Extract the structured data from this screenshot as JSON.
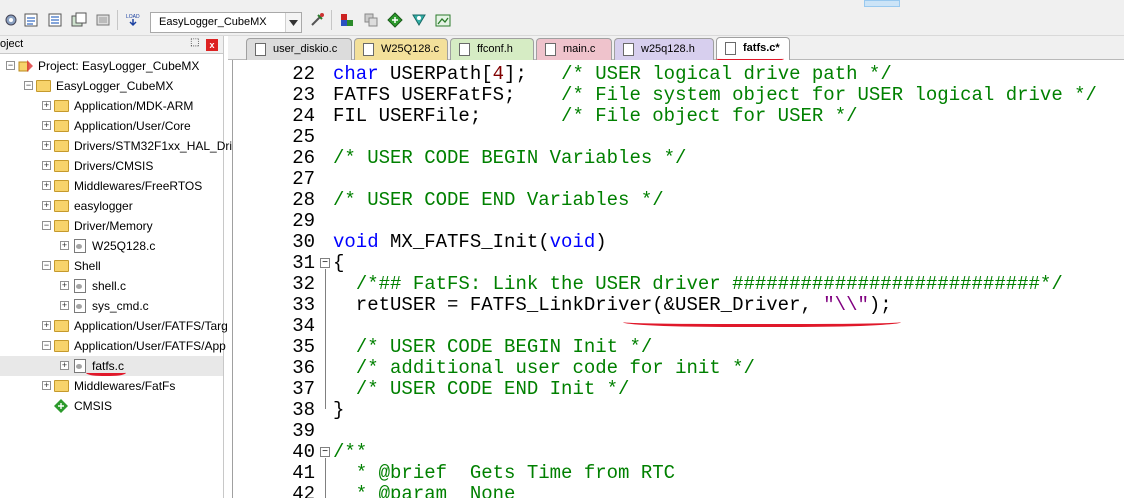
{
  "toolbar": {
    "target_name": "EasyLogger_CubeMX",
    "icons": [
      "settings-icon",
      "translate-icon",
      "build-icon",
      "rebuild-icon",
      "batch-build-icon",
      "download-icon",
      "target-options-icon",
      "manage-components-icon",
      "pack-installer-icon",
      "select-device-icon",
      "run-env-icon"
    ]
  },
  "project": {
    "panel_title": "oject",
    "pin": "⬚",
    "close": "x",
    "tree": [
      {
        "label": "Project: EasyLogger_CubeMX",
        "depth": 0,
        "expander": "−",
        "icon": "project"
      },
      {
        "label": "EasyLogger_CubeMX",
        "depth": 1,
        "expander": "−",
        "icon": "folder"
      },
      {
        "label": "Application/MDK-ARM",
        "depth": 2,
        "expander": "+",
        "icon": "folder"
      },
      {
        "label": "Application/User/Core",
        "depth": 2,
        "expander": "+",
        "icon": "folder"
      },
      {
        "label": "Drivers/STM32F1xx_HAL_Driv",
        "depth": 2,
        "expander": "+",
        "icon": "folder"
      },
      {
        "label": "Drivers/CMSIS",
        "depth": 2,
        "expander": "+",
        "icon": "folder"
      },
      {
        "label": "Middlewares/FreeRTOS",
        "depth": 2,
        "expander": "+",
        "icon": "folder"
      },
      {
        "label": "easylogger",
        "depth": 2,
        "expander": "+",
        "icon": "folder"
      },
      {
        "label": "Driver/Memory",
        "depth": 2,
        "expander": "−",
        "icon": "folder"
      },
      {
        "label": "W25Q128.c",
        "depth": 3,
        "expander": "+",
        "icon": "file"
      },
      {
        "label": "Shell",
        "depth": 2,
        "expander": "−",
        "icon": "folder"
      },
      {
        "label": "shell.c",
        "depth": 3,
        "expander": "+",
        "icon": "file"
      },
      {
        "label": "sys_cmd.c",
        "depth": 3,
        "expander": "+",
        "icon": "file"
      },
      {
        "label": "Application/User/FATFS/Targ",
        "depth": 2,
        "expander": "+",
        "icon": "folder"
      },
      {
        "label": "Application/User/FATFS/App",
        "depth": 2,
        "expander": "−",
        "icon": "folder"
      },
      {
        "label": "fatfs.c",
        "depth": 3,
        "expander": "+",
        "icon": "file",
        "selected": true
      },
      {
        "label": "Middlewares/FatFs",
        "depth": 2,
        "expander": "+",
        "icon": "folder"
      },
      {
        "label": "CMSIS",
        "depth": 2,
        "expander": "",
        "icon": "diamond"
      }
    ]
  },
  "tabs": [
    {
      "label": "user_diskio.c",
      "color": "#dcdcdc",
      "active": false
    },
    {
      "label": "W25Q128.c",
      "color": "#f3e09a",
      "active": false
    },
    {
      "label": "ffconf.h",
      "color": "#d6ecc4",
      "active": false
    },
    {
      "label": "main.c",
      "color": "#efc3cc",
      "active": false
    },
    {
      "label": "w25q128.h",
      "color": "#d7cfee",
      "active": false
    },
    {
      "label": "fatfs.c*",
      "color": "#ffffff",
      "active": true
    }
  ],
  "editor": {
    "lines": [
      {
        "n": "22",
        "html": "<span class=\"kw\">char</span> USERPath[<span class=\"nm\">4</span>];   <span class=\"cm\">/* USER logical drive path */</span>"
      },
      {
        "n": "23",
        "html": "FATFS USERFatFS;    <span class=\"cm\">/* File system object for USER logical drive */</span>"
      },
      {
        "n": "24",
        "html": "FIL USERFile;       <span class=\"cm\">/* File object for USER */</span>"
      },
      {
        "n": "25",
        "html": ""
      },
      {
        "n": "26",
        "html": "<span class=\"cm\">/* USER CODE BEGIN Variables */</span>"
      },
      {
        "n": "27",
        "html": ""
      },
      {
        "n": "28",
        "html": "<span class=\"cm\">/* USER CODE END Variables */</span>"
      },
      {
        "n": "29",
        "html": ""
      },
      {
        "n": "30",
        "html": "<span class=\"kw\">void</span> MX_FATFS_Init(<span class=\"kw\">void</span>)"
      },
      {
        "n": "31",
        "html": "{",
        "fold": "−"
      },
      {
        "n": "32",
        "html": "  <span class=\"cm\">/*## FatFS: Link the USER driver ###########################*/</span>"
      },
      {
        "n": "33",
        "html": "  retUSER = FATFS_LinkDriver(&amp;USER_Driver, <span class=\"st\">\"\\\\\"</span>);"
      },
      {
        "n": "34",
        "html": ""
      },
      {
        "n": "35",
        "html": "  <span class=\"cm\">/* USER CODE BEGIN Init */</span>"
      },
      {
        "n": "36",
        "html": "  <span class=\"cm\">/* additional user code for init */</span>"
      },
      {
        "n": "37",
        "html": "  <span class=\"cm\">/* USER CODE END Init */</span>"
      },
      {
        "n": "38",
        "html": "}"
      },
      {
        "n": "39",
        "html": ""
      },
      {
        "n": "40",
        "html": "<span class=\"cm\">/**</span>",
        "fold": "−"
      },
      {
        "n": "41",
        "html": "<span class=\"cm\">  * @brief  Gets Time from RTC</span>"
      },
      {
        "n": "42",
        "html": "<span class=\"cm\">  * @param  None</span>"
      }
    ]
  }
}
